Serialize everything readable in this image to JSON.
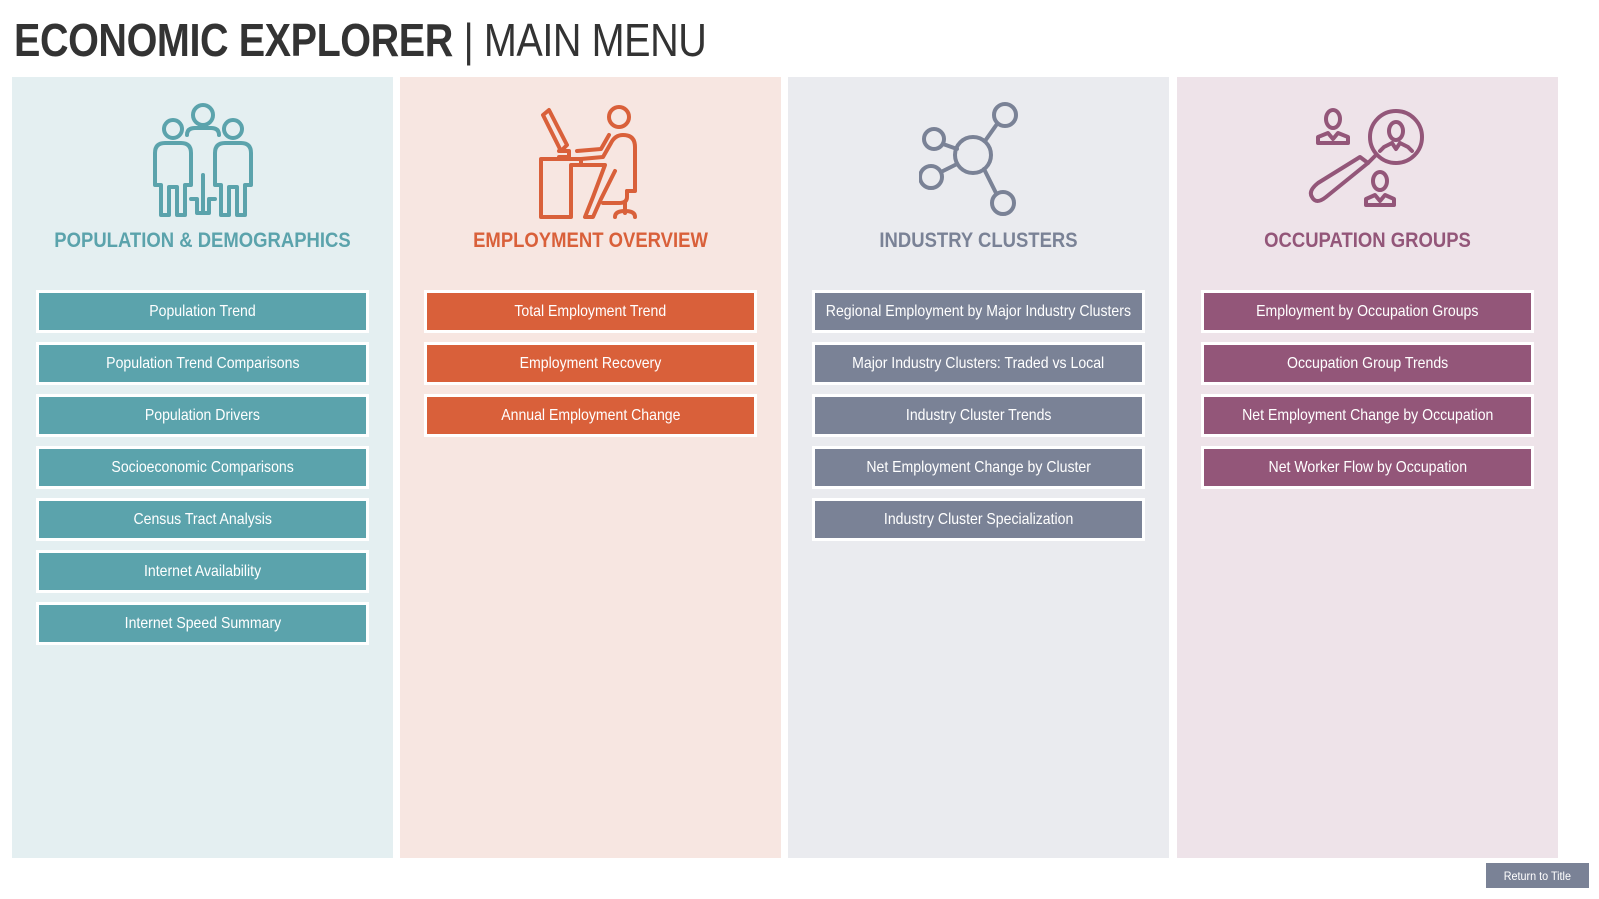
{
  "header": {
    "title_bold": "ECONOMIC EXPLORER",
    "separator": " | ",
    "title_light": "MAIN MENU"
  },
  "panels": [
    {
      "title": "POPULATION & DEMOGRAPHICS",
      "icon": "people-group-icon",
      "accent": "#5ba3ac",
      "background": "#e4eff1",
      "buttons": [
        "Population Trend",
        "Population Trend Comparisons",
        "Population Drivers",
        "Socioeconomic Comparisons",
        "Census Tract Analysis",
        "Internet Availability",
        "Internet Speed Summary"
      ]
    },
    {
      "title": "EMPLOYMENT OVERVIEW",
      "icon": "worker-at-desk-icon",
      "accent": "#d9603a",
      "background": "#f7e6e1",
      "buttons": [
        "Total Employment Trend",
        "Employment Recovery",
        "Annual Employment Change"
      ]
    },
    {
      "title": "INDUSTRY CLUSTERS",
      "icon": "network-nodes-icon",
      "accent": "#7a8296",
      "background": "#eaebef",
      "buttons": [
        "Regional Employment by Major Industry Clusters",
        "Major Industry Clusters: Traded vs Local",
        "Industry Cluster Trends",
        "Net Employment Change by Cluster",
        "Industry Cluster Specialization"
      ]
    },
    {
      "title": "OCCUPATION GROUPS",
      "icon": "people-search-icon",
      "accent": "#935679",
      "background": "#eee3e9",
      "buttons": [
        "Employment by Occupation Groups",
        "Occupation Group Trends",
        "Net Employment Change by Occupation",
        "Net Worker Flow by Occupation"
      ]
    }
  ],
  "footer": {
    "return_label": "Return to Title"
  }
}
